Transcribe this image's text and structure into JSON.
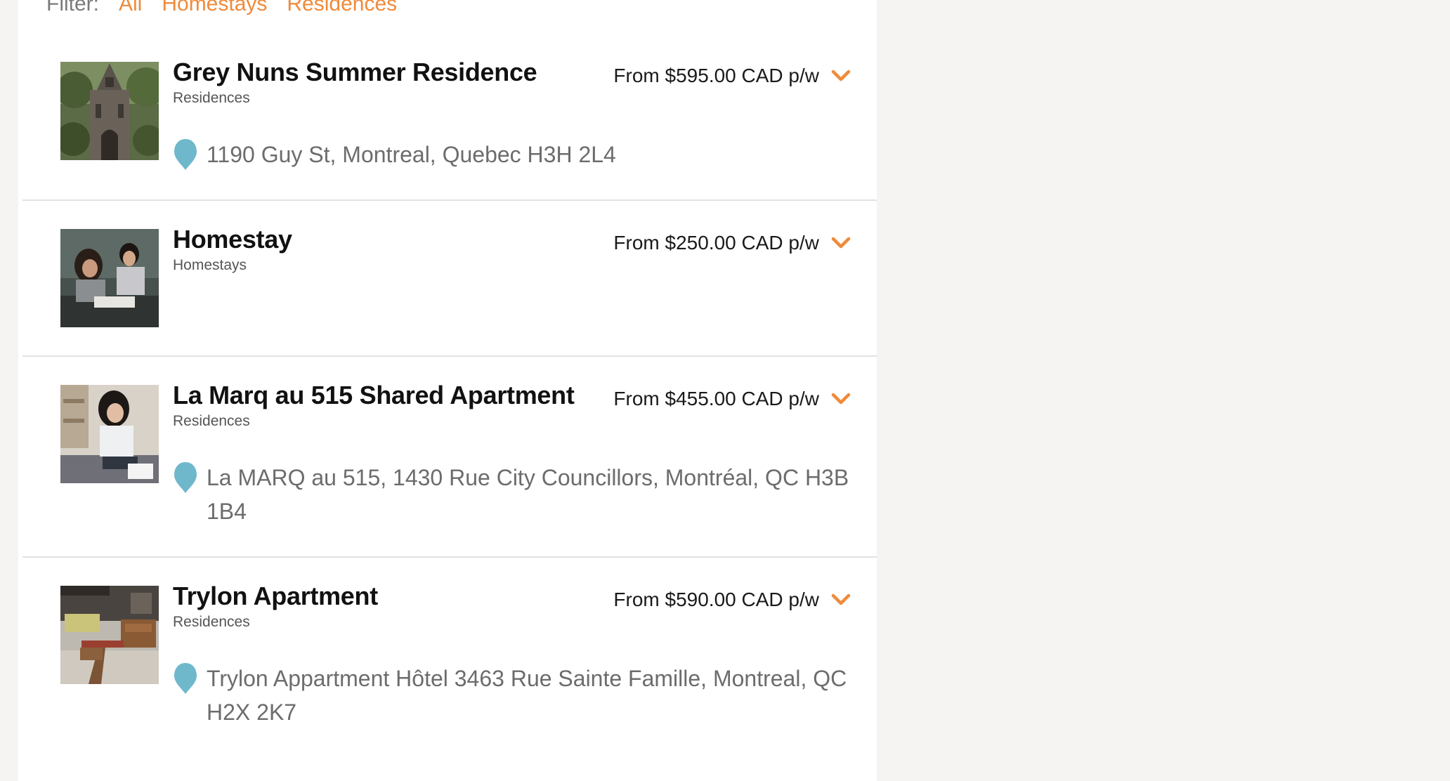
{
  "filter": {
    "label": "Filter:",
    "options": [
      "All",
      "Homestays",
      "Residences"
    ]
  },
  "colors": {
    "accent": "#f08a3a",
    "pin": "#6fb8cc",
    "divider": "#e2e2e2",
    "page_background": "#f5f4f2"
  },
  "listings": [
    {
      "title": "Grey Nuns Summer Residence",
      "category": "Residences",
      "price": "From $595.00 CAD p/w",
      "address": "1190 Guy St, Montreal, Quebec H3H 2L4",
      "thumbnail": "church-building-photo"
    },
    {
      "title": "Homestay",
      "category": "Homestays",
      "price": "From $250.00 CAD p/w",
      "address": "",
      "thumbnail": "students-reading-photo"
    },
    {
      "title": "La Marq au 515 Shared Apartment",
      "category": "Residences",
      "price": "From $455.00 CAD p/w",
      "address": "La MARQ au 515, 1430 Rue City Councillors, Montréal, QC H3B 1B4",
      "thumbnail": "student-on-bed-photo"
    },
    {
      "title": "Trylon Apartment",
      "category": "Residences",
      "price": "From $590.00 CAD p/w",
      "address": "Trylon Appartment Hôtel 3463 Rue Sainte Famille, Montreal, QC H2X 2K7",
      "thumbnail": "apartment-lounge-photo"
    }
  ]
}
